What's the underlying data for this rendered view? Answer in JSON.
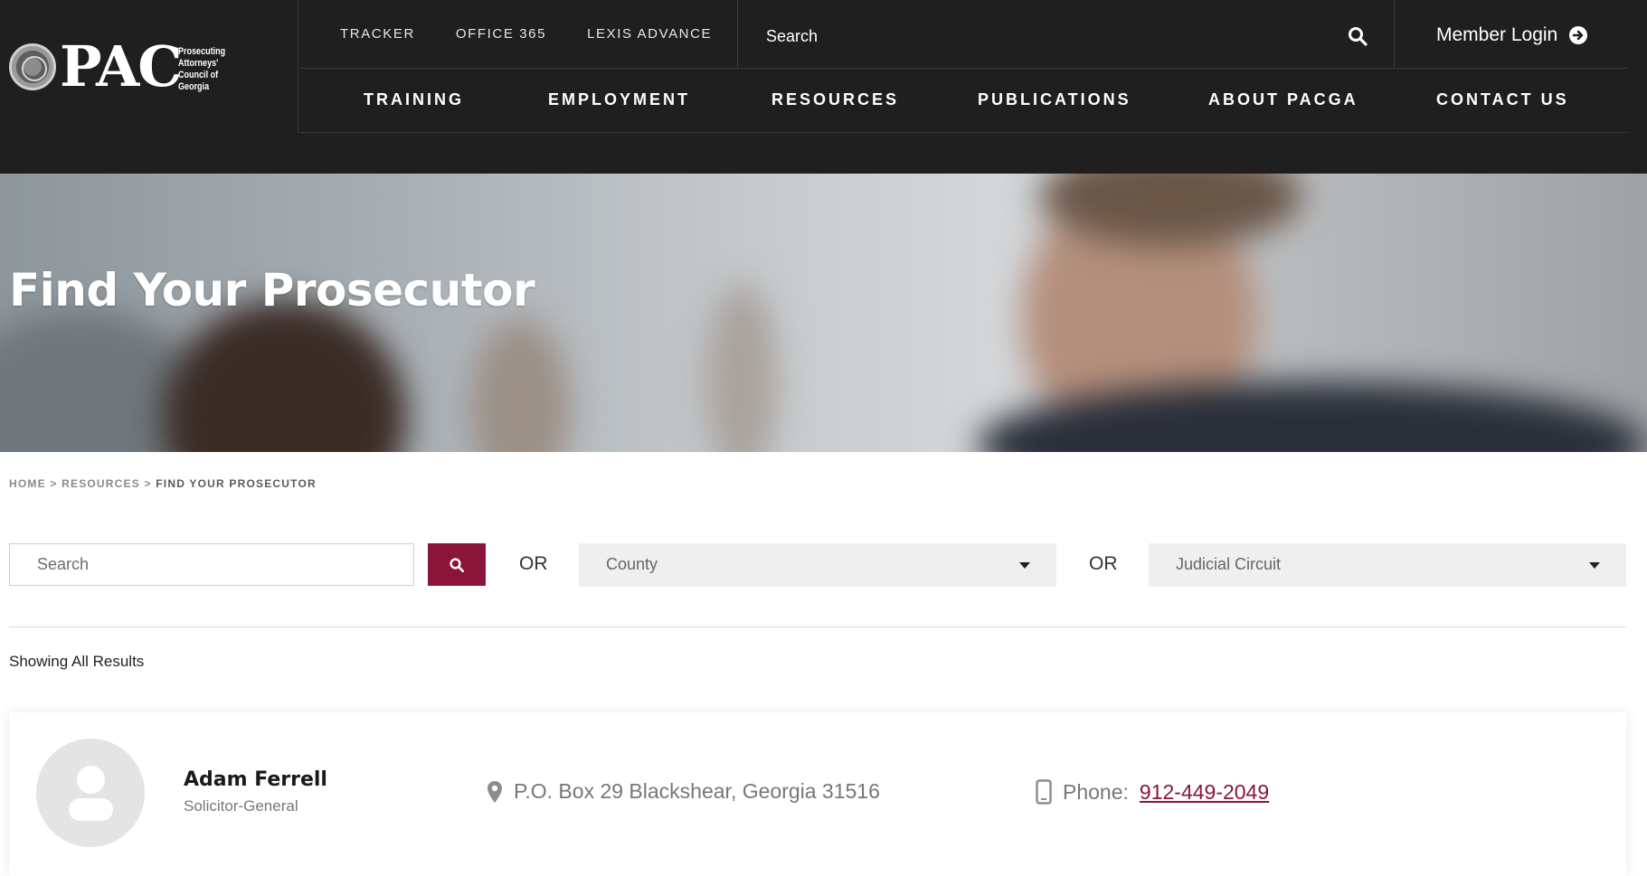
{
  "header": {
    "logo": {
      "text": "PAC",
      "subtitle": "Prosecuting Attorneys' Council of Georgia"
    },
    "utility_links": [
      "TRACKER",
      "OFFICE 365",
      "LEXIS ADVANCE"
    ],
    "search": {
      "placeholder": "Search"
    },
    "member_login": "Member Login",
    "main_nav": [
      "TRAINING",
      "EMPLOYMENT",
      "RESOURCES",
      "PUBLICATIONS",
      "ABOUT PACGA",
      "CONTACT US"
    ]
  },
  "hero": {
    "title": "Find Your Prosecutor"
  },
  "breadcrumb": {
    "home": "HOME",
    "sep1": ">",
    "resources": "RESOURCES",
    "sep2": ">",
    "current": "FIND YOUR PROSECUTOR"
  },
  "filters": {
    "search_placeholder": "Search",
    "or_label": "OR",
    "county": "County",
    "judicial_circuit": "Judicial Circuit"
  },
  "results": {
    "summary": "Showing All Results",
    "items": [
      {
        "name": "Adam Ferrell",
        "title": "Solicitor-General",
        "address": "P.O. Box 29 Blackshear, Georgia 31516",
        "phone_label": "Phone:",
        "phone": "912-449-2049"
      }
    ]
  },
  "colors": {
    "header_bg": "#1f1f1f",
    "accent": "#8a1538",
    "select_bg": "#efefef"
  },
  "icons": [
    "seal-icon",
    "search-icon",
    "arrow-circle-right-icon",
    "caret-down-icon",
    "map-pin-icon",
    "mobile-phone-icon",
    "user-avatar-icon"
  ]
}
